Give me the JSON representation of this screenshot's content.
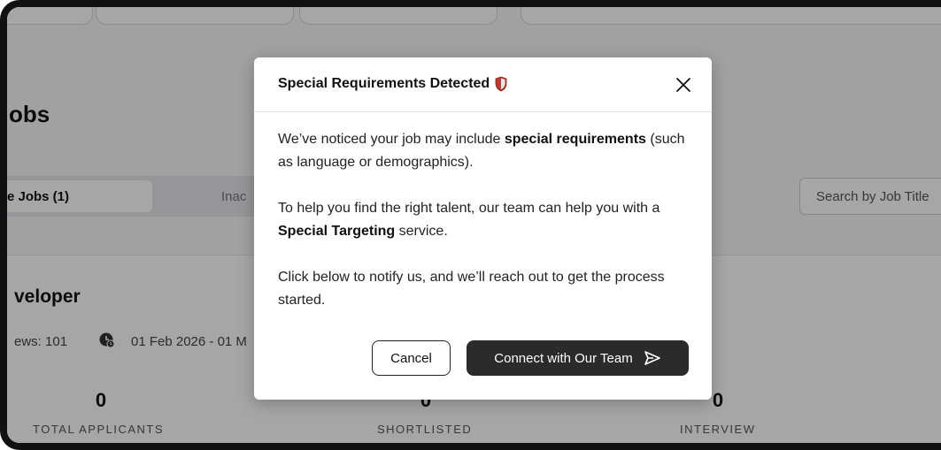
{
  "page": {
    "title": "obs",
    "tabs": {
      "active": "e Jobs (1)",
      "inactive": "Inac"
    },
    "search_placeholder": "Search by Job Title"
  },
  "job": {
    "title": "veloper",
    "views": "ews: 101",
    "date_range": "01 Feb 2026 - 01 M",
    "stats": [
      {
        "value": "0",
        "label": "TOTAL APPLICANTS"
      },
      {
        "value": "0",
        "label": "SHORTLISTED"
      },
      {
        "value": "0",
        "label": "INTERVIEW"
      }
    ]
  },
  "modal": {
    "title": "Special Requirements Detected",
    "title_icon": "shield-icon",
    "p1_pre": "We’ve noticed your job may include ",
    "p1_bold": "special requirements",
    "p1_post": " (such as language or demographics).",
    "p2_pre": "To help you find the right talent, our team can help you with a ",
    "p2_bold": "Special Targeting",
    "p2_post": " service.",
    "p3": "Click below to notify us, and we’ll reach out to get the process started.",
    "cancel_label": "Cancel",
    "connect_label": "Connect with Our Team",
    "connect_icon": "send-icon"
  },
  "colors": {
    "overlay": "#000000",
    "primary_button": "#2b2b2b",
    "shield_red": "#c0392b"
  }
}
